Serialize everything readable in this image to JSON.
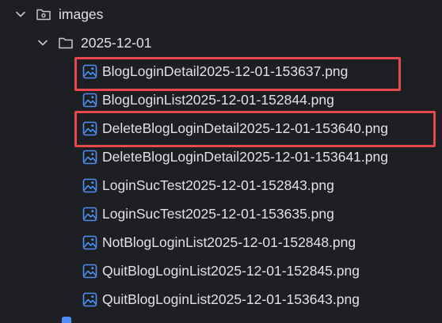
{
  "tree": {
    "folder_images": {
      "label": "images",
      "icon": "folder-icon",
      "expanded": true
    },
    "folder_date": {
      "label": "2025-12-01",
      "icon": "folder-icon",
      "expanded": true
    },
    "files": [
      {
        "name": "BlogLoginDetail2025-12-01-153637.png",
        "icon": "image-file-icon",
        "highlighted": true
      },
      {
        "name": "BlogLoginList2025-12-01-152844.png",
        "icon": "image-file-icon",
        "highlighted": false
      },
      {
        "name": "DeleteBlogLoginDetail2025-12-01-153640.png",
        "icon": "image-file-icon",
        "highlighted": true
      },
      {
        "name": "DeleteBlogLoginDetail2025-12-01-153641.png",
        "icon": "image-file-icon",
        "highlighted": false
      },
      {
        "name": "LoginSucTest2025-12-01-152843.png",
        "icon": "image-file-icon",
        "highlighted": false
      },
      {
        "name": "LoginSucTest2025-12-01-153635.png",
        "icon": "image-file-icon",
        "highlighted": false
      },
      {
        "name": "NotBlogLoginList2025-12-01-152848.png",
        "icon": "image-file-icon",
        "highlighted": false
      },
      {
        "name": "QuitBlogLoginList2025-12-01-152845.png",
        "icon": "image-file-icon",
        "highlighted": false
      },
      {
        "name": "QuitBlogLoginList2025-12-01-153643.png",
        "icon": "image-file-icon",
        "highlighted": false
      }
    ]
  },
  "colors": {
    "background": "#1e1f22",
    "text": "#dfe1e5",
    "folder_icon": "#c4c7cc",
    "image_icon": "#4d8ff6",
    "highlight_border": "#e5484d"
  }
}
